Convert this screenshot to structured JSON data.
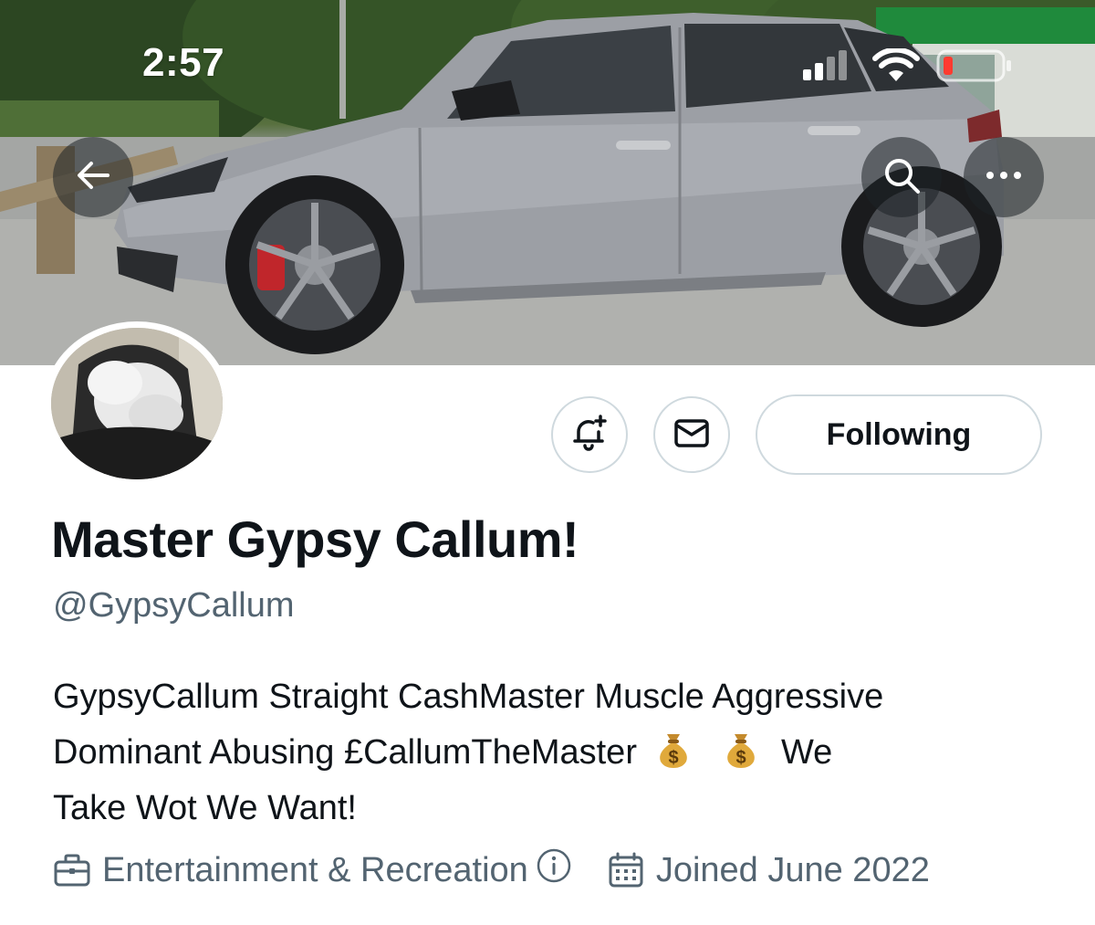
{
  "status_bar": {
    "time": "2:57",
    "signal_icon": "cellular-signal-icon",
    "wifi_icon": "wifi-icon",
    "battery_icon": "battery-low-icon"
  },
  "header": {
    "back_icon": "back-arrow-icon",
    "search_icon": "search-icon",
    "more_icon": "more-options-icon"
  },
  "profile": {
    "display_name": "Master Gypsy Callum!",
    "handle": "@GypsyCallum",
    "bio_lines": [
      "GypsyCallum Straight CashMaster Muscle Aggressive",
      "Dominant Abusing £CallumTheMaster",
      "We",
      "Take Wot We Want!"
    ],
    "bio_emoji": "money-bag-icon",
    "category": "Entertainment & Recreation",
    "joined": "Joined June 2022"
  },
  "actions": {
    "notify_icon": "bell-plus-icon",
    "message_icon": "envelope-icon",
    "following_label": "Following"
  },
  "colors": {
    "text_primary": "#0f1419",
    "text_secondary": "#536471",
    "button_border": "#cfd9de",
    "overlay_button": "#1e2226"
  }
}
